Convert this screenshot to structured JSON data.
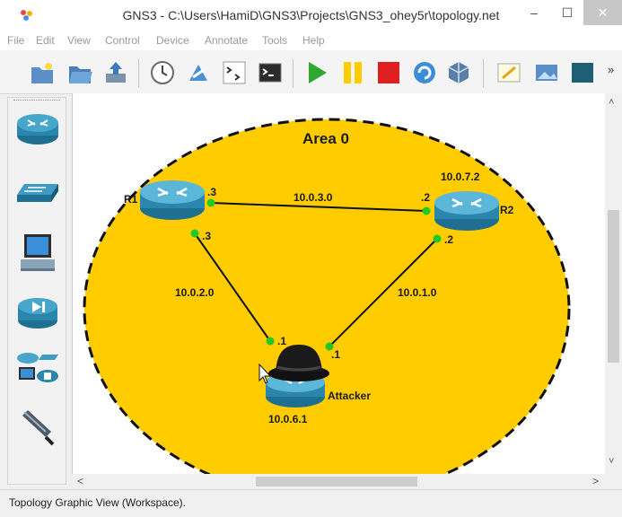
{
  "window": {
    "title": "GNS3 - C:\\Users\\HamiD\\GNS3\\Projects\\GNS3_ohey5r\\topology.net",
    "minimize": "–",
    "maximize": "☐",
    "close": "✕"
  },
  "menu": [
    "File",
    "Edit",
    "View",
    "Control",
    "Device",
    "Annotate",
    "Tools",
    "Help"
  ],
  "toolbar": {
    "buttons": [
      "new-project",
      "open-project",
      "save-project",
      "snapshot",
      "auto-link",
      "console-all-chevron",
      "console",
      "start-all",
      "suspend-all",
      "stop-all",
      "reload-all",
      "virtualbox",
      "add-note",
      "insert-image",
      "draw-rectangle"
    ],
    "more": "»"
  },
  "sidebar": {
    "devices": [
      "routers",
      "switches",
      "end-devices",
      "security-devices",
      "all-devices",
      "add-link"
    ]
  },
  "topology": {
    "area_label": "Area 0",
    "nodes": [
      {
        "id": "R1",
        "label": "R1"
      },
      {
        "id": "R2",
        "label": "R2",
        "ip": "10.0.7.2"
      },
      {
        "id": "Attacker",
        "label": "Attacker",
        "ip": "10.0.6.1"
      }
    ],
    "links": [
      {
        "from": "R1",
        "to": "R2",
        "network": "10.0.3.0",
        "from_port": ".3",
        "to_port": ".2"
      },
      {
        "from": "R1",
        "to": "Attacker",
        "network": "10.0.2.0",
        "from_port": ".3",
        "to_port": ".1"
      },
      {
        "from": "R2",
        "to": "Attacker",
        "network": "10.0.1.0",
        "from_port": ".2",
        "to_port": ".1"
      }
    ],
    "colors": {
      "area_fill": "#ffcc00",
      "link_dot": "#22c922",
      "router_body": "#3a8fb0"
    }
  },
  "scrollbars": {
    "up": "˄",
    "down": "˅",
    "left": "<",
    "right": ">"
  },
  "status": "Topology Graphic View (Workspace)."
}
